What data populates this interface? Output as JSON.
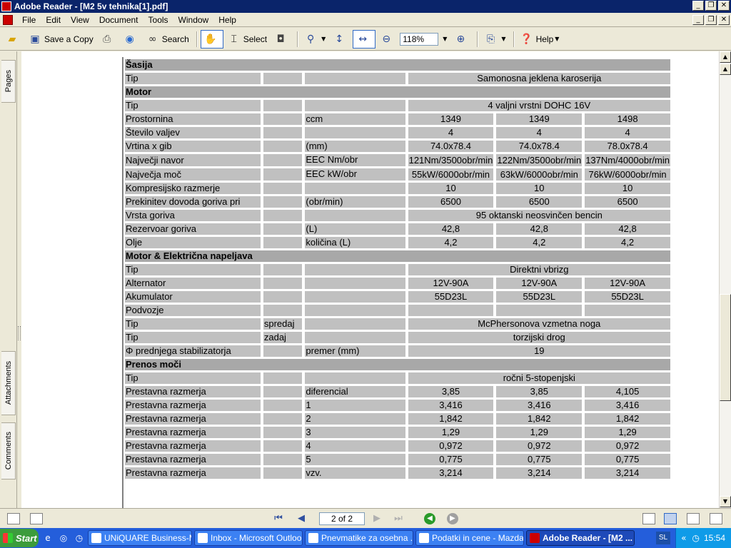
{
  "window": {
    "title": "Adobe Reader - [M2 5v tehnika[1].pdf]",
    "min": "_",
    "max": "❐",
    "close": "✕"
  },
  "menu": [
    "File",
    "Edit",
    "View",
    "Document",
    "Tools",
    "Window",
    "Help"
  ],
  "toolbar": {
    "save_copy": "Save a Copy",
    "search": "Search",
    "select": "Select",
    "zoom": "118%",
    "help": "Help"
  },
  "sidebar_tabs": {
    "pages": "Pages",
    "attachments": "Attachments",
    "comments": "Comments"
  },
  "table": {
    "rows": [
      {
        "kind": "section",
        "label": "Šasija"
      },
      {
        "kind": "span",
        "c1": "Tip",
        "c2": "",
        "c3": "",
        "span": "Samonosna jeklena karoserija"
      },
      {
        "kind": "section",
        "label": "Motor"
      },
      {
        "kind": "span",
        "c1": "Tip",
        "c2": "",
        "c3": "",
        "span": "4 valjni vrstni DOHC 16V"
      },
      {
        "kind": "vals",
        "c1": "Prostornina",
        "c2": "",
        "c3": "ccm",
        "v": [
          "1349",
          "1349",
          "1498"
        ]
      },
      {
        "kind": "vals",
        "c1": "Število valjev",
        "c2": "",
        "c3": "",
        "v": [
          "4",
          "4",
          "4"
        ]
      },
      {
        "kind": "vals",
        "c1": "Vrtina x gib",
        "c2": "",
        "c3": "(mm)",
        "v": [
          "74.0x78.4",
          "74.0x78.4",
          "78.0x78.4"
        ]
      },
      {
        "kind": "tall",
        "c1": "Največji navor",
        "c2": "",
        "c3": "EEC Nm/obr",
        "v": [
          "121Nm/3500obr/min",
          "122Nm/3500obr/min",
          "137Nm/4000obr/min"
        ]
      },
      {
        "kind": "tall",
        "c1": "Največja moč",
        "c2": "",
        "c3": "EEC kW/obr",
        "v": [
          "55kW/6000obr/min",
          "63kW/6000obr/min",
          "76kW/6000obr/min"
        ]
      },
      {
        "kind": "vals",
        "c1": "Kompresijsko razmerje",
        "c2": "",
        "c3": "",
        "v": [
          "10",
          "10",
          "10"
        ]
      },
      {
        "kind": "vals",
        "c1": "Prekinitev dovoda goriva pri",
        "c2": "",
        "c3": "(obr/min)",
        "v": [
          "6500",
          "6500",
          "6500"
        ]
      },
      {
        "kind": "span",
        "c1": "Vrsta goriva",
        "c2": "",
        "c3": "",
        "span": "95 oktanski neosvinčen bencin"
      },
      {
        "kind": "vals",
        "c1": "Rezervoar goriva",
        "c2": "",
        "c3": "(L)",
        "v": [
          "42,8",
          "42,8",
          "42,8"
        ]
      },
      {
        "kind": "vals",
        "c1": "Olje",
        "c2": "",
        "c3": "količina  (L)",
        "v": [
          "4,2",
          "4,2",
          "4,2"
        ]
      },
      {
        "kind": "section",
        "label": "Motor & Električna napeljava"
      },
      {
        "kind": "span",
        "c1": "Tip",
        "c2": "",
        "c3": "",
        "span": "Direktni vbrizg"
      },
      {
        "kind": "vals",
        "c1": "Alternator",
        "c2": "",
        "c3": "",
        "v": [
          "12V-90A",
          "12V-90A",
          "12V-90A"
        ]
      },
      {
        "kind": "vals",
        "c1": "Akumulator",
        "c2": "",
        "c3": "",
        "v": [
          "55D23L",
          "55D23L",
          "55D23L"
        ]
      },
      {
        "kind": "vals",
        "c1": "Podvozje",
        "c2": "",
        "c3": "",
        "v": [
          "",
          "",
          ""
        ]
      },
      {
        "kind": "span",
        "c1": "Tip",
        "c2": "spredaj",
        "c3": "",
        "span": "McPhersonova vzmetna noga"
      },
      {
        "kind": "span",
        "c1": "Tip",
        "c2": "zadaj",
        "c3": "",
        "span": "torzijski drog"
      },
      {
        "kind": "span",
        "c1": "Φ prednjega stabilizatorja",
        "c2": "",
        "c3": "premer (mm)",
        "span": "19"
      },
      {
        "kind": "section",
        "label": "Prenos moči"
      },
      {
        "kind": "span",
        "c1": "Tip",
        "c2": "",
        "c3": "",
        "span": "ročni 5-stopenjski"
      },
      {
        "kind": "vals",
        "c1": "Prestavna razmerja",
        "c2": "",
        "c3": "diferencial",
        "v": [
          "3,85",
          "3,85",
          "4,105"
        ]
      },
      {
        "kind": "vals",
        "c1": "Prestavna razmerja",
        "c2": "",
        "c3": "1",
        "v": [
          "3,416",
          "3,416",
          "3,416"
        ]
      },
      {
        "kind": "vals",
        "c1": "Prestavna razmerja",
        "c2": "",
        "c3": "2",
        "v": [
          "1,842",
          "1,842",
          "1,842"
        ]
      },
      {
        "kind": "vals",
        "c1": "Prestavna razmerja",
        "c2": "",
        "c3": "3",
        "v": [
          "1,29",
          "1,29",
          "1,29"
        ]
      },
      {
        "kind": "vals",
        "c1": "Prestavna razmerja",
        "c2": "",
        "c3": "4",
        "v": [
          "0,972",
          "0,972",
          "0,972"
        ]
      },
      {
        "kind": "vals",
        "c1": "Prestavna razmerja",
        "c2": "",
        "c3": "5",
        "v": [
          "0,775",
          "0,775",
          "0,775"
        ]
      },
      {
        "kind": "vals",
        "c1": "Prestavna razmerja",
        "c2": "",
        "c3": "vzv.",
        "v": [
          "3,214",
          "3,214",
          "3,214"
        ]
      }
    ]
  },
  "status": {
    "page": "2 of 2"
  },
  "taskbar": {
    "start": "Start",
    "tasks": [
      {
        "label": "UNiQUARE Business-M...",
        "active": false
      },
      {
        "label": "Inbox - Microsoft Outlook",
        "active": false
      },
      {
        "label": "Pnevmatike za osebna ...",
        "active": false
      },
      {
        "label": "Podatki in cene - Mazda...",
        "active": false
      },
      {
        "label": "Adobe Reader - [M2 ...",
        "active": true
      }
    ],
    "lang": "SL",
    "clock": "15:54"
  }
}
